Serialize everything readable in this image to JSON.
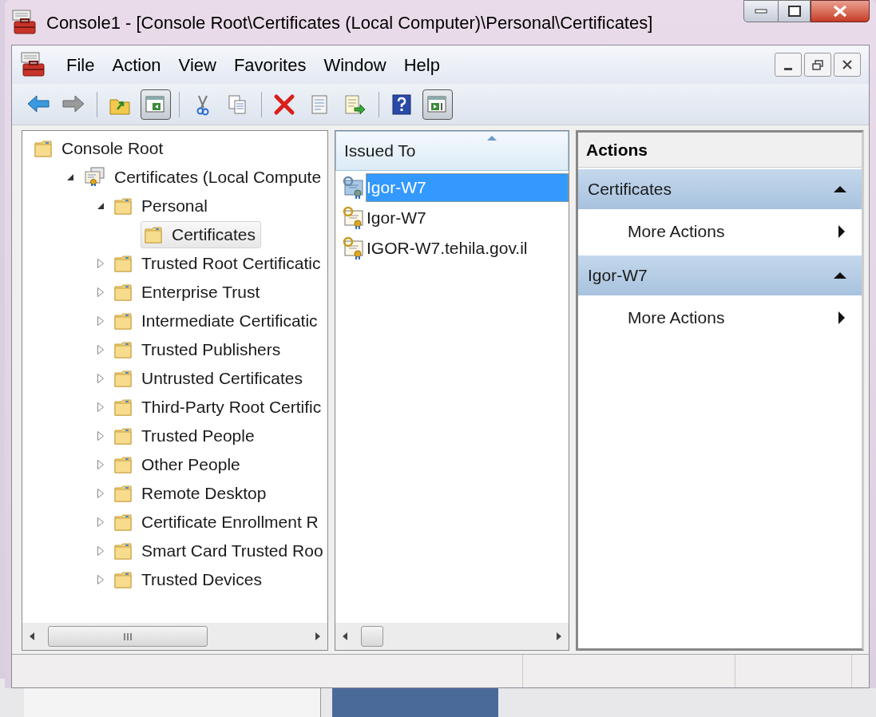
{
  "window": {
    "title": "Console1 - [Console Root\\Certificates (Local Computer)\\Personal\\Certificates]"
  },
  "menu": [
    "File",
    "Action",
    "View",
    "Favorites",
    "Window",
    "Help"
  ],
  "toolbar": [
    {
      "kind": "back",
      "pressed": false
    },
    {
      "kind": "forward",
      "pressed": false
    },
    {
      "kind": "separator"
    },
    {
      "kind": "up",
      "pressed": false
    },
    {
      "kind": "tree",
      "pressed": true
    },
    {
      "kind": "separator"
    },
    {
      "kind": "cut",
      "pressed": false
    },
    {
      "kind": "copy",
      "pressed": false
    },
    {
      "kind": "separator"
    },
    {
      "kind": "delete",
      "pressed": false
    },
    {
      "kind": "properties",
      "pressed": false
    },
    {
      "kind": "export",
      "pressed": false
    },
    {
      "kind": "separator"
    },
    {
      "kind": "help",
      "pressed": false
    },
    {
      "kind": "actionpane",
      "pressed": true
    }
  ],
  "tree": [
    {
      "label": "Console Root",
      "kind": "folder",
      "selected": false,
      "children": [
        {
          "label": "Certificates (Local Compute",
          "kind": "store",
          "selected": false,
          "expanded": true,
          "children": [
            {
              "label": "Personal",
              "kind": "folder",
              "selected": false,
              "expanded": true,
              "children": [
                {
                  "label": "Certificates",
                  "kind": "folder",
                  "selected": true
                }
              ]
            },
            {
              "label": "Trusted Root Certificatic",
              "kind": "folder",
              "selected": false,
              "expanded": false
            },
            {
              "label": "Enterprise Trust",
              "kind": "folder",
              "selected": false,
              "expanded": false
            },
            {
              "label": "Intermediate Certificatic",
              "kind": "folder",
              "selected": false,
              "expanded": false
            },
            {
              "label": "Trusted Publishers",
              "kind": "folder",
              "selected": false,
              "expanded": false
            },
            {
              "label": "Untrusted Certificates",
              "kind": "folder",
              "selected": false,
              "expanded": false
            },
            {
              "label": "Third-Party Root Certific",
              "kind": "folder",
              "selected": false,
              "expanded": false
            },
            {
              "label": "Trusted People",
              "kind": "folder",
              "selected": false,
              "expanded": false
            },
            {
              "label": "Other People",
              "kind": "folder",
              "selected": false,
              "expanded": false
            },
            {
              "label": "Remote Desktop",
              "kind": "folder",
              "selected": false,
              "expanded": false
            },
            {
              "label": "Certificate Enrollment R",
              "kind": "folder",
              "selected": false,
              "expanded": false
            },
            {
              "label": "Smart Card Trusted Roo",
              "kind": "folder",
              "selected": false,
              "expanded": false
            },
            {
              "label": "Trusted Devices",
              "kind": "folder",
              "selected": false,
              "expanded": false
            }
          ]
        }
      ]
    }
  ],
  "list": {
    "columns": [
      {
        "label": "Issued To",
        "sorted": true
      }
    ],
    "rows": [
      {
        "issued_to": "Igor-W7",
        "selected": true
      },
      {
        "issued_to": "Igor-W7",
        "selected": false
      },
      {
        "issued_to": "IGOR-W7.tehila.gov.il",
        "selected": false
      }
    ]
  },
  "actions": {
    "title": "Actions",
    "sections": [
      {
        "title": "Certificates",
        "expanded": true,
        "items": [
          "More Actions"
        ]
      },
      {
        "title": "Igor-W7",
        "expanded": true,
        "items": [
          "More Actions"
        ]
      }
    ]
  }
}
